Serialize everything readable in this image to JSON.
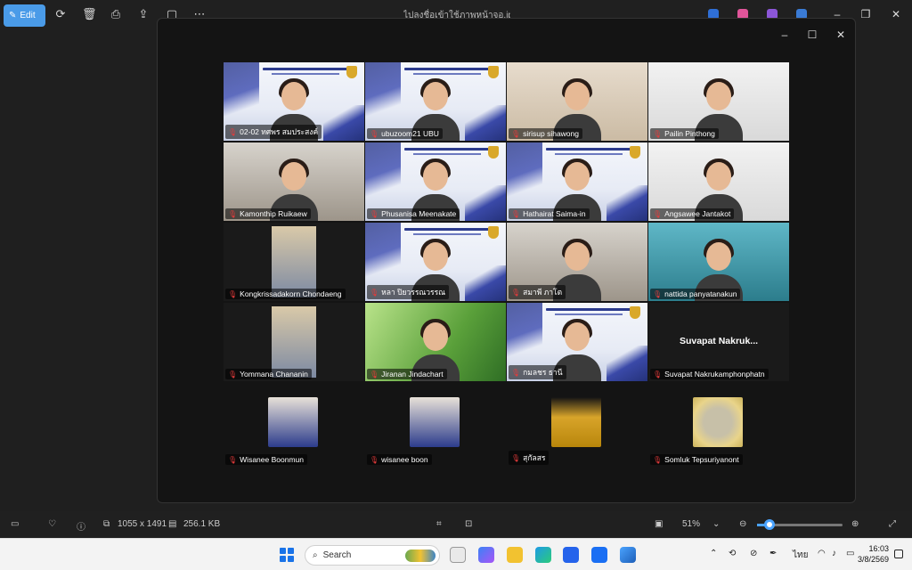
{
  "topbar": {
    "edit_label": "Edit",
    "file_title": "ไปลงชื่อเข้าใช้ภาพหน้าจอ.jpg"
  },
  "participants": [
    {
      "name": "02-02 ทศพร สมประสงค์",
      "bg": "banner",
      "active": false
    },
    {
      "name": "ubuzoom21 UBU",
      "bg": "banner",
      "active": true
    },
    {
      "name": "sirisup sihawong",
      "bg": "beige",
      "active": false
    },
    {
      "name": "Pailin Pinthong",
      "bg": "white",
      "active": false
    },
    {
      "name": "Kamonthip Ruikaew",
      "bg": "room",
      "active": false
    },
    {
      "name": "Phusanisa Meenakate",
      "bg": "banner",
      "active": false
    },
    {
      "name": "Hathairat Saima-in",
      "bg": "banner",
      "active": false
    },
    {
      "name": "Angsawee Jantakot",
      "bg": "white",
      "active": false
    },
    {
      "name": "Kongkrissadakorn Chondaeng",
      "bg": "dark",
      "active": false
    },
    {
      "name": "หลา ปิยวรรณวรรณ",
      "bg": "banner",
      "active": false
    },
    {
      "name": "สมาพี ภาโต",
      "bg": "room",
      "active": false
    },
    {
      "name": "nattida panyatanakun",
      "bg": "teal",
      "active": false
    },
    {
      "name": "Yommana Chananin",
      "bg": "dark",
      "active": false
    },
    {
      "name": "Jiranan Jindachart",
      "bg": "green",
      "active": false
    },
    {
      "name": "กมลชร ธานี",
      "bg": "banner",
      "active": false
    },
    {
      "name": "Suvapat Nakrukamphonphatn",
      "bg": "dark",
      "active": false,
      "display_name": "Suvapat  Nakruk..."
    }
  ],
  "bottom_participants": [
    {
      "name": "Wisanee Boonmun"
    },
    {
      "name": "wisanee boon"
    },
    {
      "name": "สุกัลสร"
    },
    {
      "name": "Somluk Tepsuriyanont"
    }
  ],
  "bottombar": {
    "dimensions": "1055 x 1491",
    "filesize": "256.1 KB",
    "zoom": "51%",
    "zoom_fraction": 0.51
  },
  "taskbar": {
    "search_placeholder": "Search",
    "lang": "ไทย",
    "time": "16:03",
    "date": "3/8/2569"
  },
  "colors": {
    "edit_accent": "#4a9be8",
    "active_speaker": "#2fd17a",
    "mic_off": "#e53b3b"
  }
}
